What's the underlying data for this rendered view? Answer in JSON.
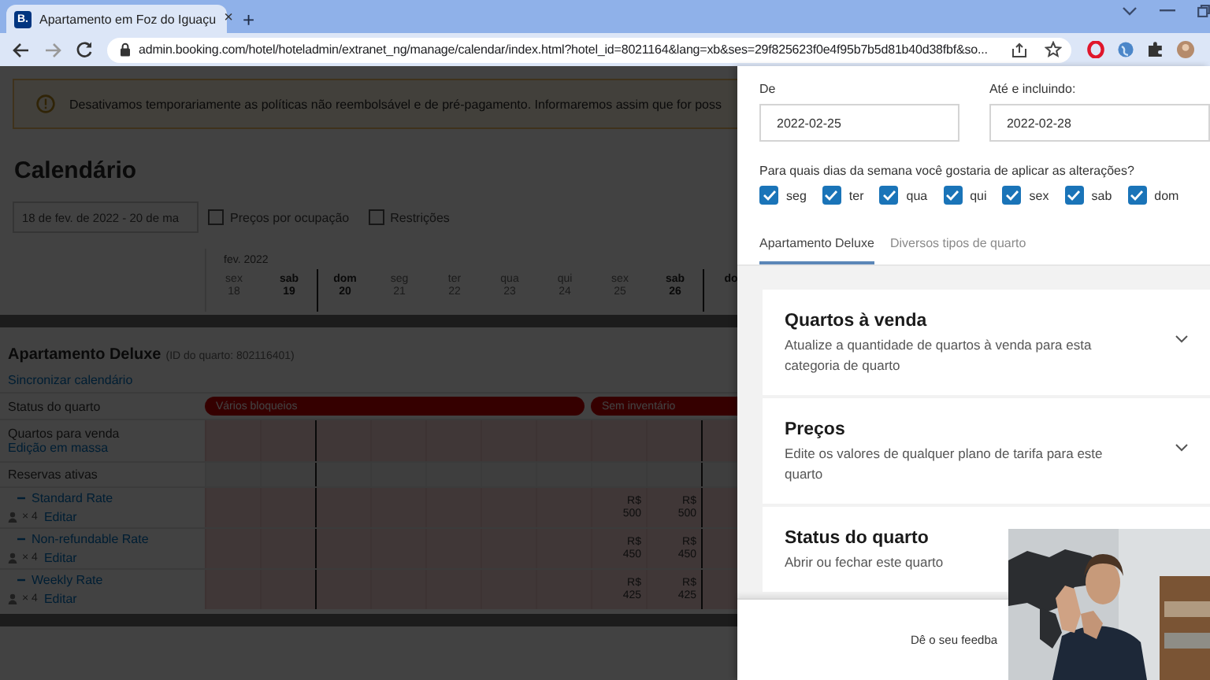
{
  "browser": {
    "favicon": "B.",
    "tab_title": "Apartamento em Foz do Iguaçu",
    "tab_close": "×",
    "new_tab": "+",
    "url": "admin.booking.com/hotel/hoteladmin/extranet_ng/manage/calendar/index.html?hotel_id=8021164&lang=xb&ses=29f825623f0e4f95b7b5d81b40d38fbf&so..."
  },
  "notice": "Desativamos temporariamente as políticas não reembolsável e de pré-pagamento. Informaremos assim que for poss",
  "page_title": "Calendário",
  "date_range": "18 de fev. de 2022 - 20 de ma",
  "options": [
    {
      "label": "Preços por ocupação",
      "checked": false
    },
    {
      "label": "Restrições",
      "checked": false
    }
  ],
  "calendar": {
    "month": "fev. 2022",
    "days": [
      {
        "weekday": "sex",
        "date": "18",
        "weekend": false
      },
      {
        "weekday": "sab",
        "date": "19",
        "weekend": true
      },
      {
        "weekday": "dom",
        "date": "20",
        "weekend": true
      },
      {
        "weekday": "seg",
        "date": "21",
        "weekend": false
      },
      {
        "weekday": "ter",
        "date": "22",
        "weekend": false
      },
      {
        "weekday": "qua",
        "date": "23",
        "weekend": false
      },
      {
        "weekday": "qui",
        "date": "24",
        "weekend": false
      },
      {
        "weekday": "sex",
        "date": "25",
        "weekend": false
      },
      {
        "weekday": "sab",
        "date": "26",
        "weekend": true
      },
      {
        "weekday": "do",
        "weekend": true
      }
    ]
  },
  "room": {
    "name": "Apartamento Deluxe",
    "id_note": "(ID do quarto: 802116401)",
    "sync_link": "Sincronizar calendário",
    "rows": [
      {
        "kind": "status",
        "label": "Status do quarto",
        "bars": [
          {
            "label": "Vários bloqueios"
          },
          {
            "label": "Sem inventário"
          }
        ]
      },
      {
        "kind": "inventory",
        "label": "Quartos para venda",
        "link": "Edição em massa"
      },
      {
        "kind": "reservations",
        "label": "Reservas ativas"
      },
      {
        "kind": "rate",
        "name": "Standard Rate",
        "occupancy": "× 4",
        "edit": "Editar",
        "prices": [
          {
            "currency": "R$",
            "amount": "500"
          },
          {
            "currency": "R$",
            "amount": "500"
          }
        ]
      },
      {
        "kind": "rate",
        "name": "Non-refundable Rate",
        "occupancy": "× 4",
        "edit": "Editar",
        "prices": [
          {
            "currency": "R$",
            "amount": "450"
          },
          {
            "currency": "R$",
            "amount": "450"
          }
        ]
      },
      {
        "kind": "rate",
        "name": "Weekly Rate",
        "occupancy": "× 4",
        "edit": "Editar",
        "prices": [
          {
            "currency": "R$",
            "amount": "425"
          },
          {
            "currency": "R$",
            "amount": "425"
          }
        ]
      }
    ]
  },
  "panel": {
    "from_label": "De",
    "from_value": "2022-02-25",
    "to_label": "Até e incluindo:",
    "to_value": "2022-02-28",
    "weekdays_prompt": "Para quais dias da semana você gostaria de aplicar as alterações?",
    "weekdays": [
      {
        "label": "seg",
        "checked": true
      },
      {
        "label": "ter",
        "checked": true
      },
      {
        "label": "qua",
        "checked": true
      },
      {
        "label": "qui",
        "checked": true
      },
      {
        "label": "sex",
        "checked": true
      },
      {
        "label": "sab",
        "checked": true
      },
      {
        "label": "dom",
        "checked": true
      }
    ],
    "tabs": [
      {
        "label": "Apartamento Deluxe",
        "selected": true
      },
      {
        "label": "Diversos tipos de quarto",
        "selected": false
      }
    ],
    "sections": [
      {
        "title": "Quartos à venda",
        "description": "Atualize a quantidade de quartos à venda para esta categoria de quarto",
        "chevron": true
      },
      {
        "title": "Preços",
        "description": "Edite os valores de qualquer plano de tarifa para este quarto",
        "chevron": true
      },
      {
        "title": "Status do quarto",
        "description": "Abrir ou fechar este quarto"
      }
    ],
    "feedback": "Dê o seu feedba"
  }
}
